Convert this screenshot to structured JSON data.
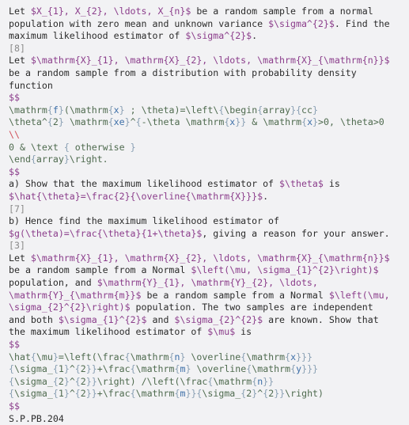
{
  "document": {
    "lines": [
      [
        {
          "k": "text",
          "v": "Let "
        },
        {
          "k": "inline",
          "v": "$X_{1}, X_{2}, \\ldots, X_{n}$"
        },
        {
          "k": "text",
          "v": " be a random sample from a normal"
        }
      ],
      [
        {
          "k": "text",
          "v": "population with zero mean and unknown variance "
        },
        {
          "k": "inline",
          "v": "$\\sigma^{2}$"
        },
        {
          "k": "text",
          "v": ". Find the"
        }
      ],
      [
        {
          "k": "text",
          "v": "maximum likelihood estimator of "
        },
        {
          "k": "inline",
          "v": "$\\sigma^{2}$"
        },
        {
          "k": "text",
          "v": "."
        }
      ],
      [
        {
          "k": "mark",
          "v": "[8]"
        }
      ],
      [
        {
          "k": "text",
          "v": "Let "
        },
        {
          "k": "inline",
          "v": "$\\mathrm{X}_{1}, \\mathrm{X}_{2}, \\ldots, \\mathrm{X}_{\\mathrm{n}}$"
        }
      ],
      [
        {
          "k": "text",
          "v": "be a random sample from a distribution with probability density"
        }
      ],
      [
        {
          "k": "text",
          "v": "function"
        }
      ],
      [
        {
          "k": "delim",
          "v": "$$"
        }
      ],
      [
        {
          "k": "display",
          "v": "\\mathrm{f}(\\mathrm{x} ; \\theta)=\\left\\{\\begin{array}{cc}"
        }
      ],
      [
        {
          "k": "display",
          "v": "\\theta^{2} \\mathrm{xe}^{-\\theta \\mathrm{x}} & \\mathrm{x}>0, \\theta>0"
        }
      ],
      [
        {
          "k": "break",
          "v": "\\\\"
        }
      ],
      [
        {
          "k": "display",
          "v": "0 & \\text { otherwise }"
        }
      ],
      [
        {
          "k": "display",
          "v": "\\end{array}\\right."
        }
      ],
      [
        {
          "k": "delim",
          "v": "$$"
        }
      ],
      [
        {
          "k": "text",
          "v": "a) Show that the maximum likelihood estimator of "
        },
        {
          "k": "inline",
          "v": "$\\theta$"
        },
        {
          "k": "text",
          "v": " is"
        }
      ],
      [
        {
          "k": "inline",
          "v": "$\\hat{\\theta}=\\frac{2}{\\overline{\\mathrm{X}}}$"
        },
        {
          "k": "text",
          "v": "."
        }
      ],
      [
        {
          "k": "mark",
          "v": "[7]"
        }
      ],
      [
        {
          "k": "text",
          "v": "b) Hence find the maximum likelihood estimator of"
        }
      ],
      [
        {
          "k": "inline",
          "v": "$g(\\theta)=\\frac{\\theta}{1+\\theta}$"
        },
        {
          "k": "text",
          "v": ", giving a reason for your answer."
        }
      ],
      [
        {
          "k": "mark",
          "v": "[3]"
        }
      ],
      [
        {
          "k": "text",
          "v": "Let "
        },
        {
          "k": "inline",
          "v": "$\\mathrm{X}_{1}, \\mathrm{X}_{2}, \\ldots, \\mathrm{X}_{\\mathrm{n}}$"
        }
      ],
      [
        {
          "k": "text",
          "v": "be a random sample from a Normal "
        },
        {
          "k": "inline",
          "v": "$\\left(\\mu, \\sigma_{1}^{2}\\right)$"
        }
      ],
      [
        {
          "k": "text",
          "v": "population, and "
        },
        {
          "k": "inline",
          "v": "$\\mathrm{Y}_{1}, \\mathrm{Y}_{2}, \\ldots,"
        }
      ],
      [
        {
          "k": "inline",
          "v": "\\mathrm{Y}_{\\mathrm{m}}$"
        },
        {
          "k": "text",
          "v": " be a random sample from a Normal "
        },
        {
          "k": "inline",
          "v": "$\\left(\\mu,"
        }
      ],
      [
        {
          "k": "inline",
          "v": "\\sigma_{2}^{2}\\right)$"
        },
        {
          "k": "text",
          "v": " population. The two samples are independent"
        }
      ],
      [
        {
          "k": "text",
          "v": "and both "
        },
        {
          "k": "inline",
          "v": "$\\sigma_{1}^{2}$"
        },
        {
          "k": "text",
          "v": " and "
        },
        {
          "k": "inline",
          "v": "$\\sigma_{2}^{2}$"
        },
        {
          "k": "text",
          "v": " are known. Show that"
        }
      ],
      [
        {
          "k": "text",
          "v": "the maximum likelihood estimator of "
        },
        {
          "k": "inline",
          "v": "$\\mu$"
        },
        {
          "k": "text",
          "v": " is"
        }
      ],
      [
        {
          "k": "delim",
          "v": "$$"
        }
      ],
      [
        {
          "k": "display",
          "v": "\\hat{\\mu}=\\left(\\frac{\\mathrm{n} \\overline{\\mathrm{x}}}"
        }
      ],
      [
        {
          "k": "display",
          "v": "{\\sigma_{1}^{2}}+\\frac{\\mathrm{m} \\overline{\\mathrm{y}}}"
        }
      ],
      [
        {
          "k": "display",
          "v": "{\\sigma_{2}^{2}}\\right) /\\left(\\frac{\\mathrm{n}}"
        }
      ],
      [
        {
          "k": "display",
          "v": "{\\sigma_{1}^{2}}+\\frac{\\mathrm{m}}{\\sigma_{2}^{2}}\\right)"
        }
      ],
      [
        {
          "k": "delim",
          "v": "$$"
        }
      ],
      [
        {
          "k": "text",
          "v": "S.P.PB.204"
        }
      ]
    ]
  }
}
